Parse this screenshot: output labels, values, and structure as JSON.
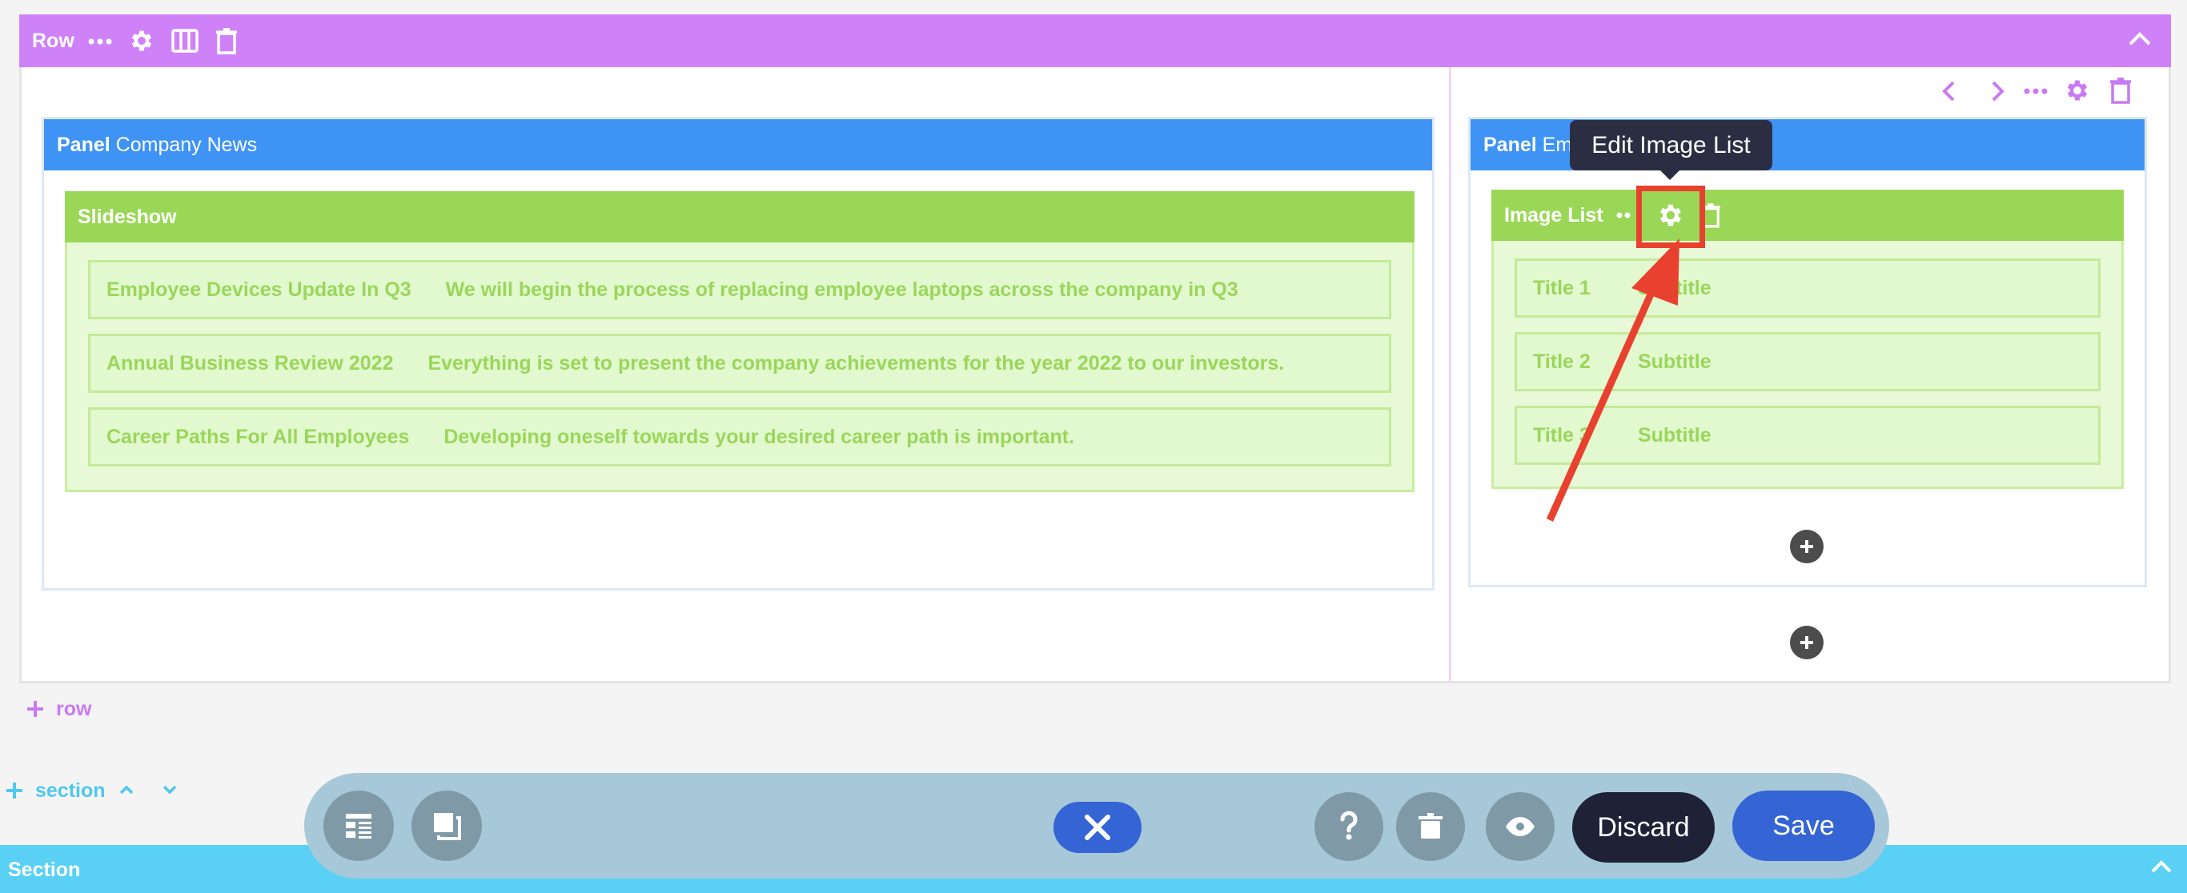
{
  "row": {
    "label": "Row",
    "add_label": "row"
  },
  "panel_left": {
    "prefix": "Panel",
    "title": "Company News",
    "module_title": "Slideshow",
    "items": [
      {
        "title": "Employee Devices Update In Q3",
        "subtitle": "We will begin the process of replacing employee laptops across the company in Q3"
      },
      {
        "title": "Annual Business Review 2022",
        "subtitle": "Everything is set to present the company achievements for the year 2022 to our investors."
      },
      {
        "title": "Career Paths For All Employees",
        "subtitle": "Developing oneself towards your desired career path is important."
      }
    ]
  },
  "panel_right": {
    "prefix": "Panel",
    "title_visible": "Emp",
    "module_title": "Image List",
    "items": [
      {
        "title": "Title 1",
        "subtitle": "Subtitle"
      },
      {
        "title": "Title 2",
        "subtitle": "Subtitle"
      },
      {
        "title": "Title 3",
        "subtitle": "Subtitle"
      }
    ]
  },
  "tooltip": {
    "text": "Edit Image List"
  },
  "section_controls": {
    "label": "section"
  },
  "toolbar": {
    "discard_label": "Discard",
    "save_label": "Save"
  },
  "section_bar": {
    "label": "Section"
  },
  "colors": {
    "row_accent": "#cf82f8",
    "panel_accent": "#3f93f5",
    "module_accent": "#9ad757",
    "section_accent": "#5ad1f4",
    "highlight": "#e8412f",
    "save_button": "#3564d4"
  }
}
